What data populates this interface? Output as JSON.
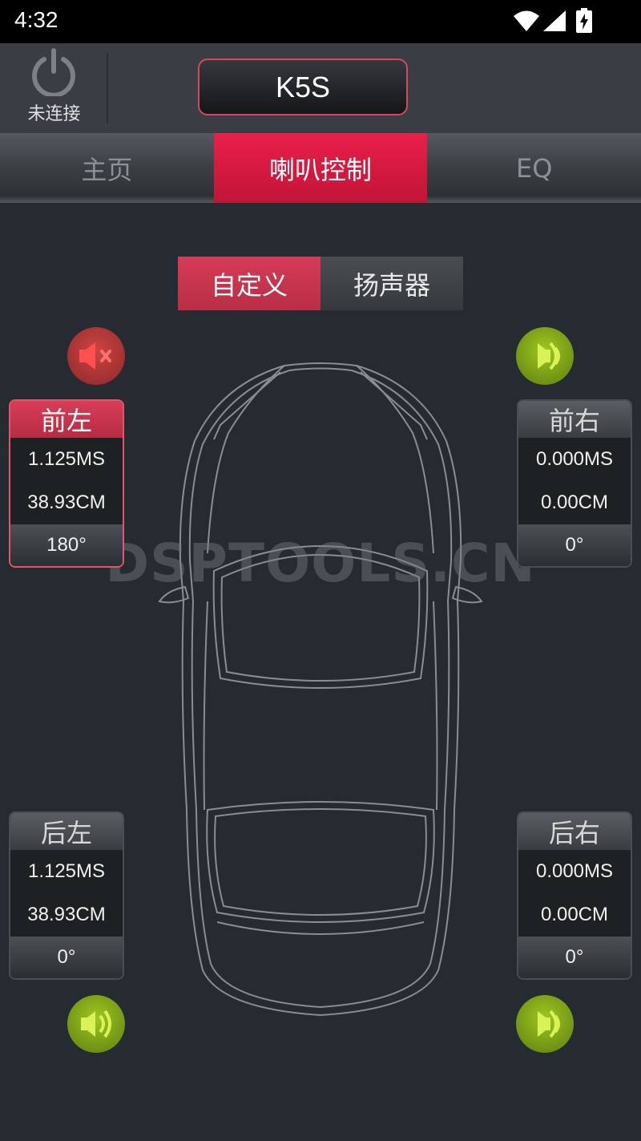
{
  "status_bar": {
    "time": "4:32",
    "wifi_icon": "wifi-icon",
    "signal_icon": "signal-icon",
    "battery_icon": "battery-charging-icon"
  },
  "header": {
    "power_status": "未连接",
    "model": "K5S"
  },
  "tabs": [
    {
      "label": "主页",
      "active": false
    },
    {
      "label": "喇叭控制",
      "active": true
    },
    {
      "label": "EQ",
      "active": false
    }
  ],
  "mode_switch": {
    "custom": "自定义",
    "speaker": "扬声器",
    "selected": "自定义"
  },
  "channels": {
    "front_left": {
      "name": "前左",
      "delay": "1.125MS",
      "distance": "38.93CM",
      "phase": "180°",
      "muted": true,
      "selected": true
    },
    "front_right": {
      "name": "前右",
      "delay": "0.000MS",
      "distance": "0.00CM",
      "phase": "0°",
      "muted": false,
      "selected": false
    },
    "rear_left": {
      "name": "后左",
      "delay": "1.125MS",
      "distance": "38.93CM",
      "phase": "0°",
      "muted": false,
      "selected": false
    },
    "rear_right": {
      "name": "后右",
      "delay": "0.000MS",
      "distance": "0.00CM",
      "phase": "0°",
      "muted": false,
      "selected": false
    }
  },
  "watermark": "DSPTOOLS.CN",
  "colors": {
    "accent": "#d2183d",
    "speaker_on": "#8fb51a",
    "speaker_muted": "#b53535",
    "background": "#262a31"
  }
}
